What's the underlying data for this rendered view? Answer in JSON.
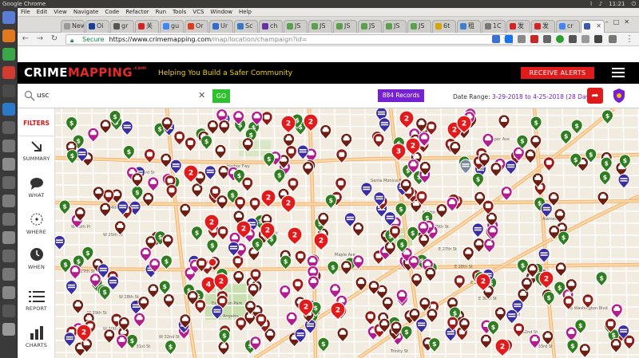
{
  "os": {
    "app_name": "Google Chrome",
    "time": "11:21"
  },
  "ide_menu": [
    "File",
    "Edit",
    "View",
    "Navigate",
    "Code",
    "Refactor",
    "Run",
    "Tools",
    "VCS",
    "Window",
    "Help"
  ],
  "browser": {
    "tabs": [
      {
        "label": "New",
        "fav": "#9a9a9a"
      },
      {
        "label": "Oi",
        "fav": "#1a3e9e"
      },
      {
        "label": "gr",
        "fav": "#555555"
      },
      {
        "label": "关",
        "fav": "#d62222"
      },
      {
        "label": "gu",
        "fav": "#4285f4"
      },
      {
        "label": "Or",
        "fav": "#e03a1a"
      },
      {
        "label": "Ur",
        "fav": "#2e6cd1"
      },
      {
        "label": "Sc",
        "fav": "#3478c6"
      },
      {
        "label": "ch",
        "fav": "#6a2ea8"
      },
      {
        "label": "JS",
        "fav": "#59a14f"
      },
      {
        "label": "JS",
        "fav": "#59a14f"
      },
      {
        "label": "JS",
        "fav": "#59a14f"
      },
      {
        "label": "JS",
        "fav": "#59a14f"
      },
      {
        "label": "JS",
        "fav": "#59a14f"
      },
      {
        "label": "JS",
        "fav": "#59a14f"
      },
      {
        "label": "6t",
        "fav": "#d9a300"
      },
      {
        "label": "租",
        "fav": "#3a7fd0"
      },
      {
        "label": "1C",
        "fav": "#777777"
      },
      {
        "label": "发",
        "fav": "#d62222"
      },
      {
        "label": "发",
        "fav": "#d62222"
      },
      {
        "label": "cr",
        "fav": "#4285f4"
      },
      {
        "label": "",
        "fav": "#3957b8",
        "active": true
      }
    ],
    "secure_label": "Secure",
    "url_host": "https://www.crimemapping.com",
    "url_path": "/map/location/champaign?id="
  },
  "site": {
    "logo_crime": "CRIME",
    "logo_mapping": "MAPPING",
    "logo_com": ".com",
    "tagline": "Helping You Build a Safer Community",
    "receive_alerts": "RECEIVE ALERTS"
  },
  "search": {
    "value": "usc",
    "go_label": "GO",
    "records_label": "884 Records",
    "date_range_label": "Date Range:",
    "date_range_value": "3-29-2018 to 4-25-2018 (28 Days)"
  },
  "sidebar": {
    "filters": "FILTERS",
    "items": [
      {
        "label": "SUMMARY",
        "icon": "arrow-diagonal-icon"
      },
      {
        "label": "WHAT",
        "icon": "speech-bubble-icon"
      },
      {
        "label": "WHERE",
        "icon": "location-target-icon"
      },
      {
        "label": "WHEN",
        "icon": "clock-icon"
      },
      {
        "label": "REPORT",
        "icon": "list-icon"
      },
      {
        "label": "CHARTS",
        "icon": "bar-chart-icon"
      }
    ]
  },
  "map": {
    "street_labels": [
      "W 23rd St",
      "W 24th St",
      "W 25th Pl",
      "W 25th St",
      "W 27th St",
      "W 28th St",
      "W 29th St",
      "W 30th St",
      "W 31st St",
      "W 32nd St",
      "E 24th St",
      "E 25th St",
      "E 27th St",
      "E 28th St",
      "E 29th St",
      "E 30th St",
      "E 31st St",
      "E 32nd St",
      "E 33rd St",
      "E Washington Blvd",
      "Exposition Park",
      "Harbor Fwy",
      "Santa Monica Fwy",
      "Los Angeles",
      "Trinity St",
      "Hooper Ave",
      "Alameda St",
      "Maple Ave",
      "Main St"
    ],
    "cluster_counts": [
      "2",
      "2",
      "2",
      "2",
      "2",
      "2",
      "2",
      "2",
      "2",
      "2",
      "2",
      "3",
      "2",
      "2",
      "2",
      "4",
      "2",
      "2",
      "2",
      "2",
      "2",
      "2",
      "2"
    ],
    "colors": {
      "theft": "#6e1d12",
      "burglary": "#8b1f18",
      "fraud": "#2f7d20",
      "assault": "#b21d8e",
      "vandalism": "#a01a1a",
      "arrest": "#3b2ea3",
      "cluster": "#e11b1b",
      "other": "#d44fb5"
    }
  }
}
